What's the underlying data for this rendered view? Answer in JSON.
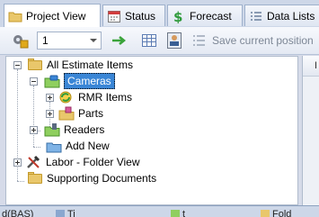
{
  "tabs": [
    {
      "label": "Project View",
      "icon": "folder-icon",
      "active": true
    },
    {
      "label": "Status",
      "icon": "calendar-icon",
      "active": false
    },
    {
      "label": "Forecast",
      "icon": "dollar-icon",
      "active": false
    },
    {
      "label": "Data Lists",
      "icon": "list-icon",
      "active": false
    }
  ],
  "toolbar": {
    "level_value": "1",
    "save_position_label": "Save current position"
  },
  "tree": {
    "root": "All Estimate Items",
    "cameras": "Cameras",
    "rmr_items": "RMR Items",
    "parts": "Parts",
    "readers": "Readers",
    "add_new": "Add New",
    "labor": "Labor - Folder View",
    "supporting": "Supporting Documents"
  },
  "right_pane": {
    "header": "I"
  },
  "bottom_tabs": [
    {
      "label": "d(BAS)"
    },
    {
      "label": "Ti"
    },
    {
      "label": "t"
    },
    {
      "label": "Fold"
    }
  ],
  "colors": {
    "selection": "#3a86d6",
    "folder": "#e9c76b",
    "forecast": "#2e9a3a"
  }
}
